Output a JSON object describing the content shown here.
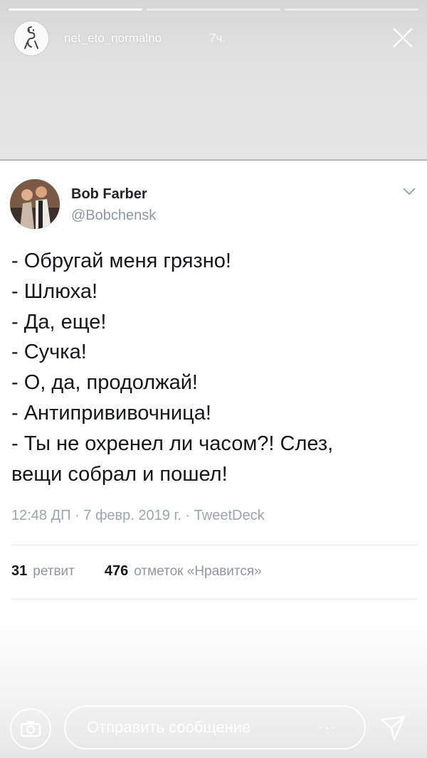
{
  "story": {
    "username": "net_eto_normalno",
    "time": "7ч.",
    "progress": {
      "segments": 3,
      "current": 1
    }
  },
  "tweet": {
    "name": "Bob Farber",
    "handle": "@Bobchensk",
    "lines": [
      "- Обругай меня грязно!",
      "- Шлюха!",
      "- Да, еще!",
      "- Сучка!",
      "- О, да, продолжай!",
      "- Антипрививочница!",
      "- Ты не охренел ли часом?! Слез,",
      "вещи собрал и пошел!"
    ],
    "meta": "12:48 ДП · 7 февр. 2019 г. · TweetDeck",
    "retweets_count": "31",
    "retweets_label": "ретвит",
    "likes_count": "476",
    "likes_label": "отметок «Нравится»"
  },
  "reply": {
    "placeholder": "Отправить сообщение",
    "more": "···"
  },
  "icons": {
    "close": "close-icon",
    "camera": "camera-icon",
    "send": "send-icon",
    "chevron": "chevron-down-icon"
  }
}
